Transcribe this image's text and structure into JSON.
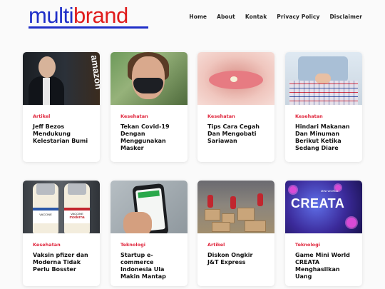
{
  "site": {
    "logo": {
      "part1": "multi",
      "part2": "brand"
    },
    "nav": [
      "Home",
      "About",
      "Kontak",
      "Privacy Policy",
      "Disclaimer"
    ]
  },
  "articles": [
    {
      "category": "Artikel",
      "title": "Jeff Bezos Mendukung Kelestarian Bumi",
      "image": "jeff-bezos-photo"
    },
    {
      "category": "Kesehatan",
      "title": "Tekan Covid-19 Dengan Menggunakan Masker",
      "image": "woman-mask-photo"
    },
    {
      "category": "Kesehatan",
      "title": "Tips Cara Cegah Dan Mengobati Sariawan",
      "image": "lip-sore-photo"
    },
    {
      "category": "Kesehatan",
      "title": "Hindari Makanan Dan Minuman Berikut Ketika Sedang Diare",
      "image": "stomach-ache-photo"
    },
    {
      "category": "Kesehatan",
      "title": "Vaksin pfizer dan Moderna Tidak Perlu Bosster",
      "image": "vaccine-vials-photo"
    },
    {
      "category": "Teknologi",
      "title": "Startup e-commerce Indonesia Ula Makin Mantap",
      "image": "phone-app-photo"
    },
    {
      "category": "Artikel",
      "title": "Diskon Ongkir J&T Express",
      "image": "warehouse-photo"
    },
    {
      "category": "Teknologi",
      "title": "Game Mini World CREATA Menghasilkan Uang",
      "image": "game-banner-photo"
    }
  ],
  "image_text": {
    "amazon": "amazon",
    "vaccine1": "VACCINE",
    "vaccine2": "VACCINE",
    "moderna": "moderna",
    "creata": "CREATA",
    "miniworld": "MINI WORLD"
  },
  "colors": {
    "logo_blue": "#1f2fc8",
    "logo_red": "#e01c1c",
    "category": "#e0283e"
  }
}
